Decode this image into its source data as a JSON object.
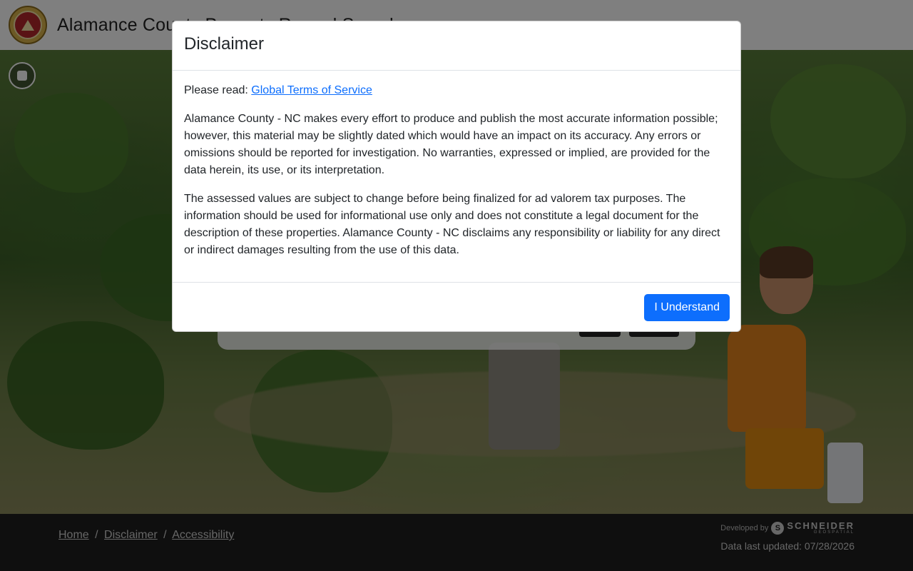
{
  "header": {
    "site_title": "Alamance County Property Record Search",
    "logo_icon": "county-seal-icon"
  },
  "hero": {
    "media_control_icon": "stop-icon"
  },
  "footer": {
    "links": [
      "Home",
      "Disclaimer",
      "Accessibility"
    ],
    "separator": "/",
    "developed_by_label": "Developed by",
    "developer_name": "SCHNEIDER",
    "developer_subname": "GEOSPATIAL",
    "data_last_updated": "Data last updated: 07/28/2026"
  },
  "modal": {
    "title": "Disclaimer",
    "please_read_label": "Please read:",
    "terms_link": "Global Terms of Service",
    "paragraph_1": "Alamance County - NC makes every effort to produce and publish the most accurate information possible; however, this material may be slightly dated which would have an impact on its accuracy. Any errors or omissions should be reported for investigation. No warranties, expressed or implied, are provided for the data herein, its use, or its interpretation.",
    "paragraph_2": "The assessed values are subject to change before being finalized for ad valorem tax purposes. The information should be used for informational use only and does not constitute a legal document for the description of these properties. Alamance County - NC disclaims any responsibility or liability for any direct or indirect damages resulting from the use of this data.",
    "confirm_button": "I Understand"
  },
  "colors": {
    "primary": "#0d6efd",
    "footer_bg": "#1e1e1e",
    "header_bg": "#ffffff"
  }
}
